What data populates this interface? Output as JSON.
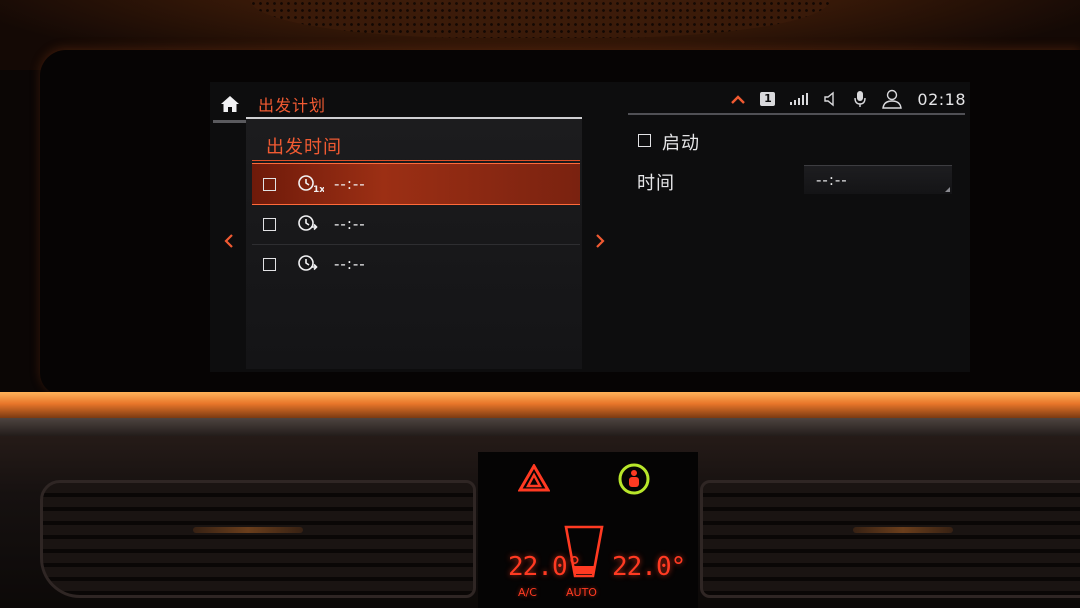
{
  "header": {
    "title": "出发计划",
    "channel_badge": "1",
    "clock": "02:18"
  },
  "departure_panel": {
    "title": "出发时间",
    "rows": [
      {
        "time": "--:--",
        "repeat_marker": "1x",
        "selected": true
      },
      {
        "time": "--:--",
        "selected": false
      },
      {
        "time": "--:--",
        "selected": false
      }
    ]
  },
  "settings_panel": {
    "activate_label": "启动",
    "time_label": "时间",
    "time_value": "--:--"
  },
  "climate": {
    "left_temp": "22.0°",
    "right_temp": "22.0°",
    "ac_label": "A/C",
    "auto_label": "AUTO"
  },
  "colors": {
    "accent": "#f05a32",
    "selection": "#9c2f14",
    "climate_display": "#ff3a22",
    "airbag_indicator": "#b8e62a"
  },
  "icons": [
    "home-icon",
    "chevron-up-icon",
    "signal-strength-icon",
    "speaker-icon",
    "microphone-icon",
    "user-profile-icon",
    "timer-icon",
    "chevron-left-icon",
    "chevron-right-icon",
    "hazard-icon",
    "passenger-airbag-icon"
  ]
}
